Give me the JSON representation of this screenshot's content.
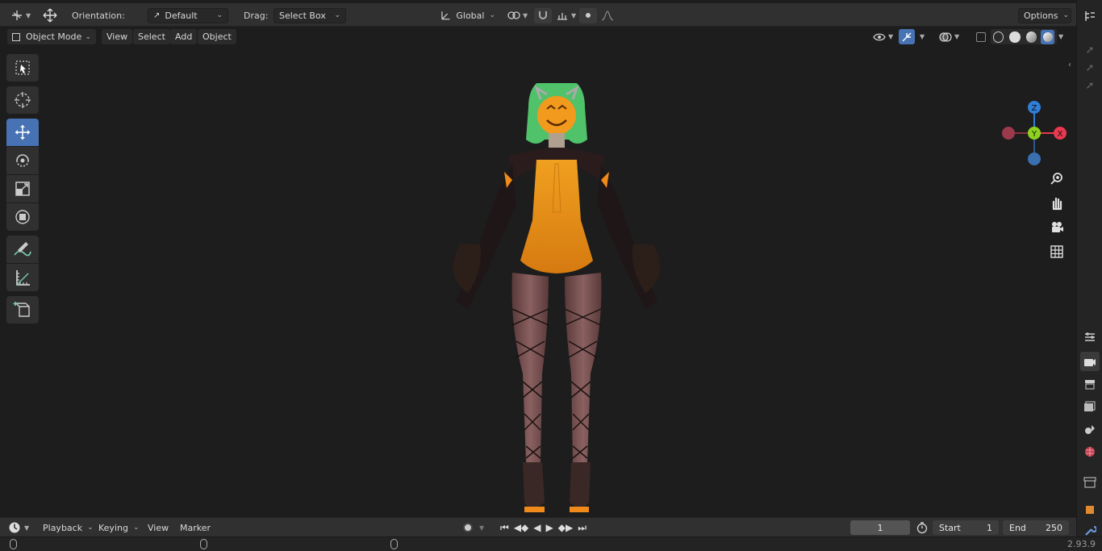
{
  "toolbar": {
    "orientation_label": "Orientation:",
    "orientation_value": "Default",
    "drag_label": "Drag:",
    "drag_value": "Select Box",
    "transform_orientation": "Global",
    "options_label": "Options"
  },
  "header": {
    "mode": "Object Mode",
    "menus": [
      "View",
      "Select",
      "Add",
      "Object"
    ]
  },
  "left_tools": [
    {
      "name": "select-box-tool",
      "icon": "select-box-icon",
      "selected": false
    },
    {
      "name": "cursor-tool",
      "icon": "cursor-icon",
      "selected": false
    },
    {
      "name": "move-tool",
      "icon": "move-icon",
      "selected": true
    },
    {
      "name": "rotate-tool",
      "icon": "rotate-icon",
      "selected": false
    },
    {
      "name": "scale-tool",
      "icon": "scale-icon",
      "selected": false
    },
    {
      "name": "transform-tool",
      "icon": "transform-icon",
      "selected": false
    },
    {
      "name": "annotate-tool",
      "icon": "annotate-icon",
      "selected": false
    },
    {
      "name": "measure-tool",
      "icon": "measure-icon",
      "selected": false
    },
    {
      "name": "add-cube-tool",
      "icon": "add-cube-icon",
      "selected": false
    }
  ],
  "gizmo": {
    "z": "Z",
    "y": "Y",
    "x": "X",
    "colors": {
      "x": "#e8394f",
      "y": "#8ed21f",
      "z": "#2f7ed8"
    }
  },
  "timeline": {
    "playback_label": "Playback",
    "keying_label": "Keying",
    "view_label": "View",
    "marker_label": "Marker",
    "current_frame": "1",
    "start_label": "Start",
    "start_value": "1",
    "end_label": "End",
    "end_value": "250"
  },
  "status": {
    "version": "2.93.9"
  },
  "colors": {
    "accent": "#4772b3",
    "background": "#1d1d1d",
    "panel": "#303030"
  }
}
